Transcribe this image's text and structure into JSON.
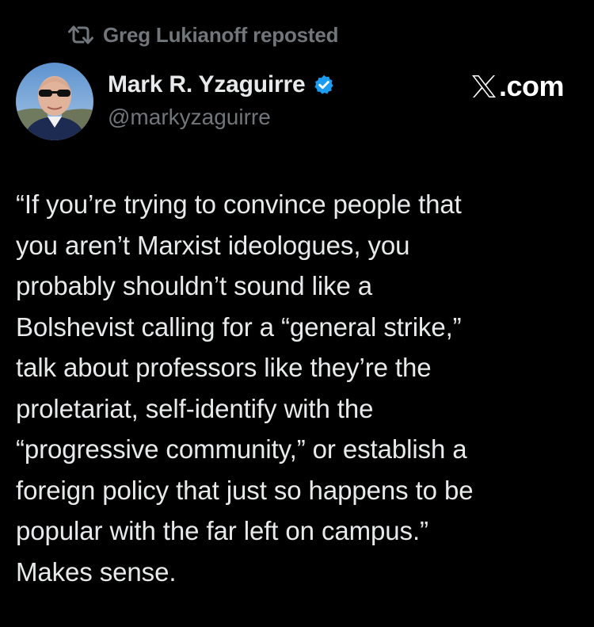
{
  "repost": {
    "text": "Greg Lukianoff reposted",
    "icon": "repost-icon"
  },
  "author": {
    "display_name": "Mark R. Yzaguirre",
    "handle": "@markyzaguirre",
    "verified_icon": "verified-badge-icon",
    "verified_color": "#1d9bf0"
  },
  "brand": {
    "domain": ".com",
    "logo_icon": "x-logo-icon"
  },
  "post": {
    "text": "“If you’re trying to convince people that\nyou aren’t Marxist ideologues, you\nprobably shouldn’t sound like a\nBolshevist calling for a “general strike,”\ntalk about professors like they’re the\nproletariat, self-identify with the\n“progressive community,” or establish a\nforeign policy that just so happens to be\npopular with the far left on campus.”\nMakes sense."
  },
  "colors": {
    "background": "#000000",
    "primary_text": "#e7e9ea",
    "secondary_text": "#71767b",
    "accent": "#1d9bf0"
  }
}
